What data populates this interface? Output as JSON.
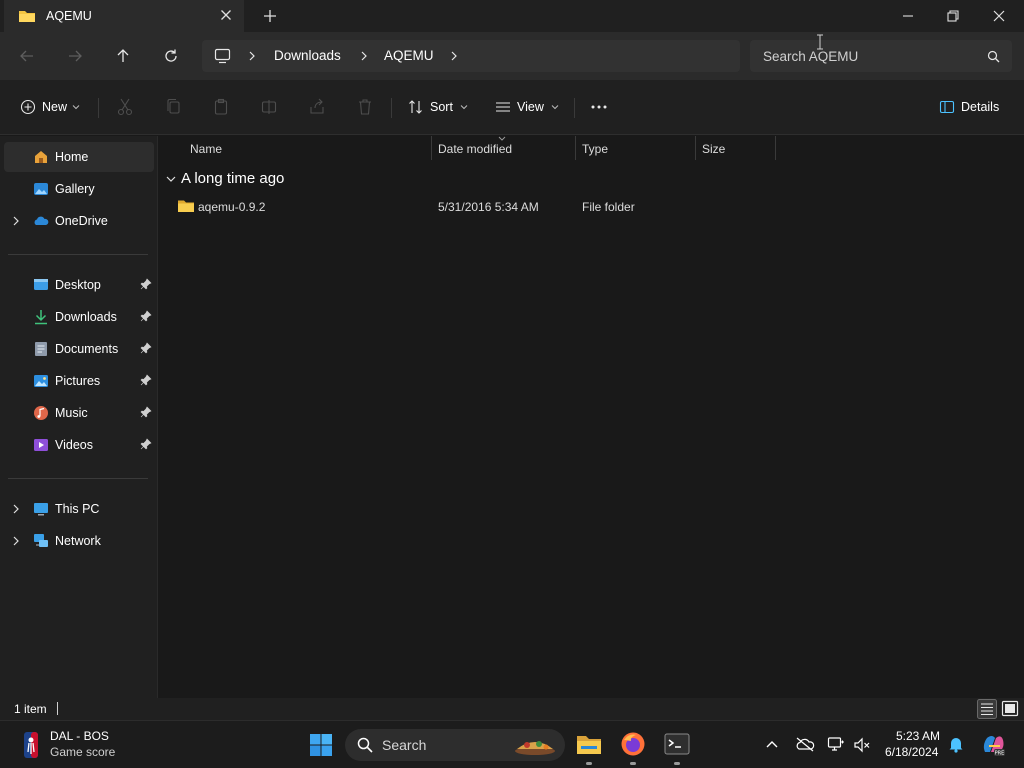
{
  "window": {
    "tab_title": "AQEMU"
  },
  "addressbar": {
    "crumbs": [
      "Downloads",
      "AQEMU"
    ]
  },
  "search": {
    "placeholder": "Search AQEMU"
  },
  "commandbar": {
    "new_label": "New",
    "sort_label": "Sort",
    "view_label": "View",
    "details_label": "Details"
  },
  "sidebar": {
    "items": [
      {
        "label": "Home",
        "icon": "home-icon",
        "selected": true
      },
      {
        "label": "Gallery",
        "icon": "gallery-icon"
      },
      {
        "label": "OneDrive",
        "icon": "onedrive-icon",
        "expandable": true
      },
      {
        "label": "Desktop",
        "icon": "desktop-icon",
        "pinned": true
      },
      {
        "label": "Downloads",
        "icon": "downloads-icon",
        "pinned": true
      },
      {
        "label": "Documents",
        "icon": "documents-icon",
        "pinned": true
      },
      {
        "label": "Pictures",
        "icon": "pictures-icon",
        "pinned": true
      },
      {
        "label": "Music",
        "icon": "music-icon",
        "pinned": true
      },
      {
        "label": "Videos",
        "icon": "videos-icon",
        "pinned": true
      },
      {
        "label": "This PC",
        "icon": "this-pc-icon",
        "expandable": true
      },
      {
        "label": "Network",
        "icon": "network-icon",
        "expandable": true
      }
    ]
  },
  "filelist": {
    "columns": [
      "Name",
      "Date modified",
      "Type",
      "Size"
    ],
    "group_label": "A long time ago",
    "rows": [
      {
        "name": "aqemu-0.9.2",
        "date_modified": "5/31/2016 5:34 AM",
        "type": "File folder",
        "size": ""
      }
    ]
  },
  "statusbar": {
    "item_count": "1 item"
  },
  "taskbar": {
    "widget_title": "DAL - BOS",
    "widget_subtitle": "Game score",
    "search_label": "Search",
    "time": "5:23 AM",
    "date": "6/18/2024"
  },
  "colors": {
    "folder": "#f4c542",
    "accent": "#4cc2ff",
    "background": "#191919",
    "panel": "#202020"
  }
}
